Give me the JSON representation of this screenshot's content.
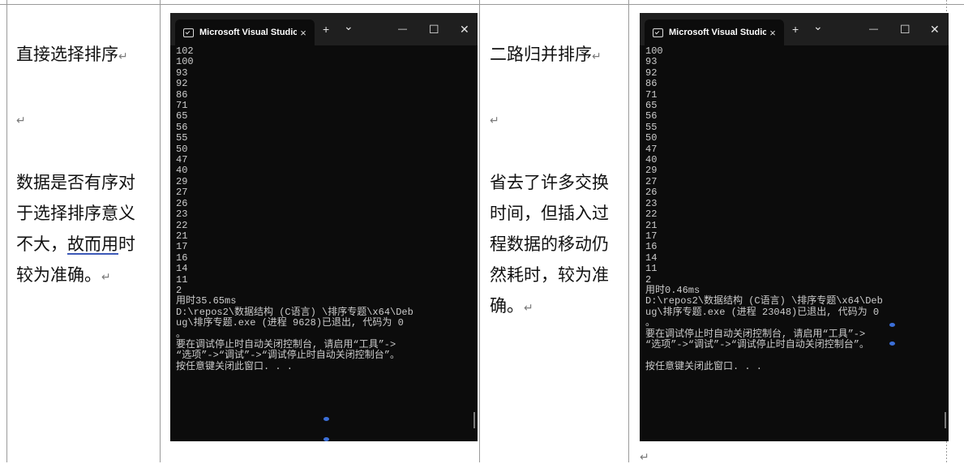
{
  "col1": {
    "title": "直接选择排序",
    "body": "数据是否有序对于选择排序意义不大，",
    "underlined": "故而用",
    "tail": "时较为准确。"
  },
  "col3": {
    "title": "二路归并排序",
    "body": "省去了许多交换时间，但插入过程数据的移动仍然耗时，较为准确。"
  },
  "terminal1": {
    "tab_title": "Microsoft Visual Studio",
    "output": "102\n100\n93\n92\n86\n71\n65\n56\n55\n50\n47\n40\n29\n27\n26\n23\n22\n21\n17\n16\n14\n11\n2\n用时35.65ms\nD:\\repos2\\数据结构 (C语言) \\排序专题\\x64\\Deb\nug\\排序专题.exe (进程 9628)已退出, 代码为 0\n。\n要在调试停止时自动关闭控制台, 请启用“工具”->\n“选项”->“调试”->“调试停止时自动关闭控制台”。\n按任意键关闭此窗口. . ."
  },
  "terminal2": {
    "tab_title": "Microsoft Visual Studio",
    "output": "100\n93\n92\n86\n71\n65\n56\n55\n50\n47\n40\n29\n27\n26\n23\n22\n21\n17\n16\n14\n11\n2\n用时0.46ms\nD:\\repos2\\数据结构 (C语言) \\排序专题\\x64\\Deb\nug\\排序专题.exe (进程 23048)已退出, 代码为 0\n。\n要在调试停止时自动关闭控制台, 请启用“工具”->\n“选项”->“调试”->“调试停止时自动关闭控制台”。\n\n按任意键关闭此窗口. . ."
  },
  "icons": {
    "tab_close": "×",
    "new_tab": "+",
    "dropdown": "⌄",
    "minimize": "—",
    "maximize": "☐",
    "close": "✕",
    "paragraph_mark": "↵"
  }
}
